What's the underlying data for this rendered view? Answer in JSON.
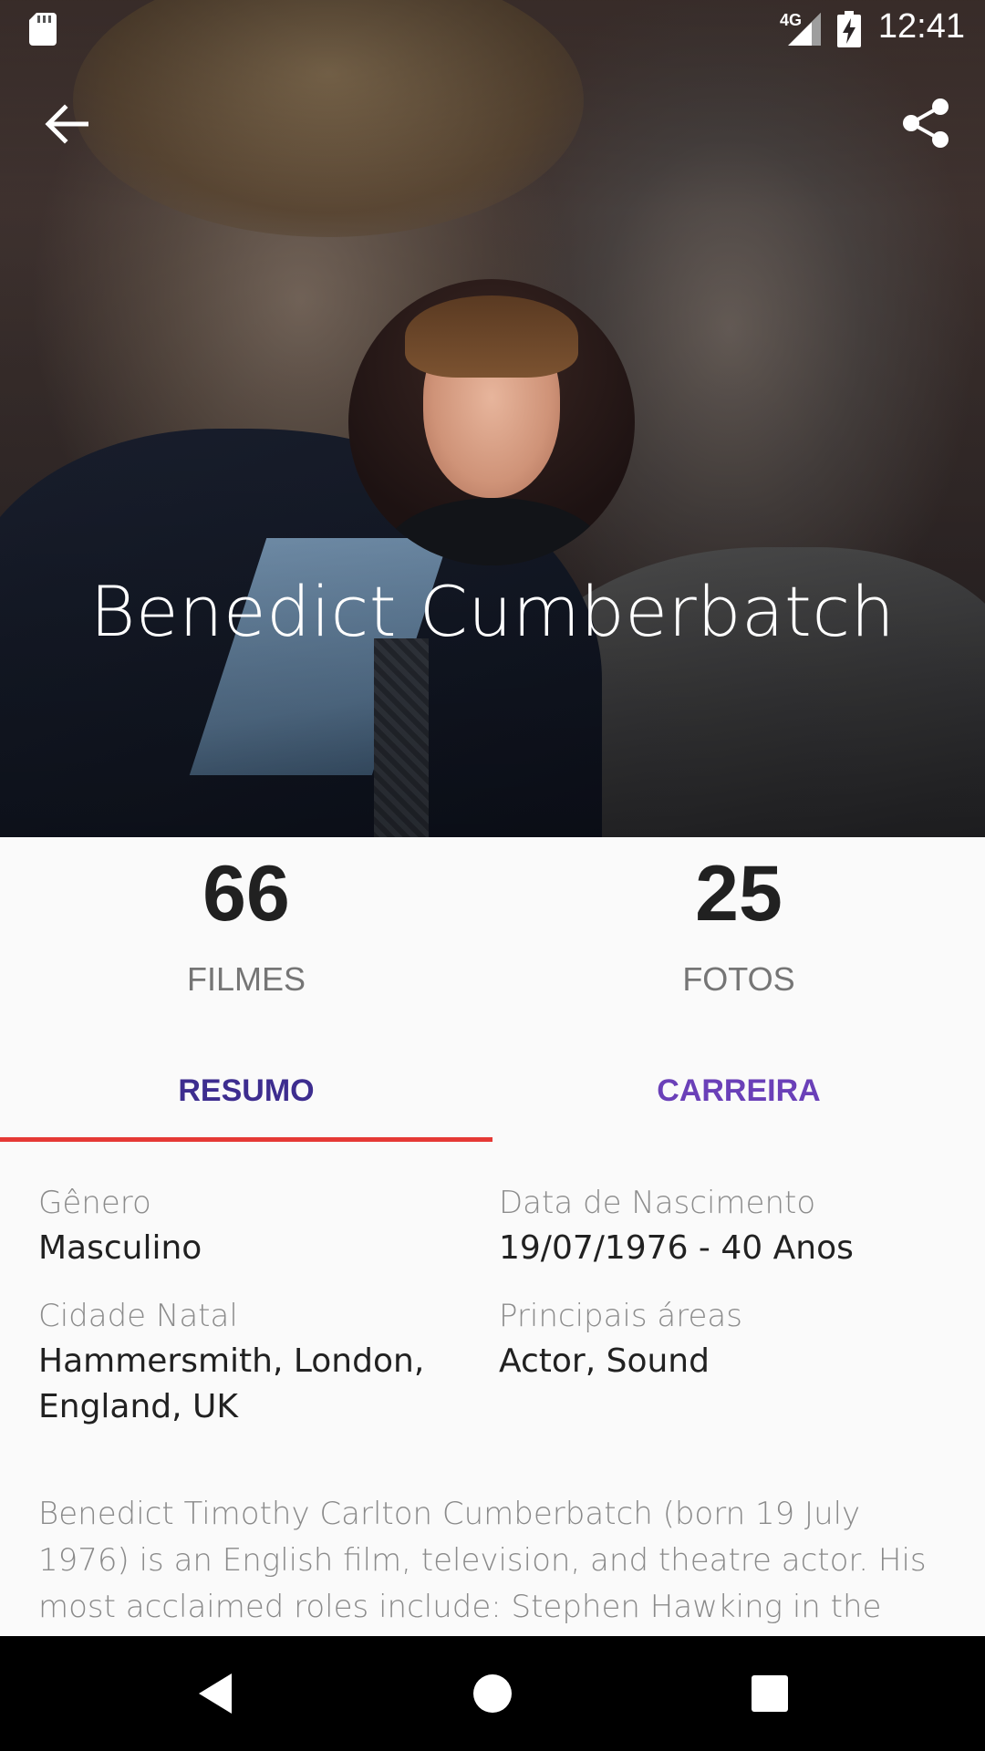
{
  "status_bar": {
    "network": "4G",
    "time": "12:41"
  },
  "toolbar": {
    "back_icon": "arrow-back-icon",
    "share_icon": "share-icon"
  },
  "profile": {
    "name": "Benedict Cumberbatch"
  },
  "stats": {
    "films": {
      "value": "66",
      "label": "FILMES"
    },
    "photos": {
      "value": "25",
      "label": "FOTOS"
    }
  },
  "tabs": [
    {
      "label": "RESUMO",
      "active": true,
      "color": "#3d2d8f"
    },
    {
      "label": "CARREIRA",
      "active": false,
      "color": "#6a40b8"
    }
  ],
  "accent_color": "#e53935",
  "details": {
    "gender": {
      "label": "Gênero",
      "value": "Masculino"
    },
    "birth": {
      "label": "Data de Nascimento",
      "value": "19/07/1976 - 40 Anos"
    },
    "city": {
      "label": "Cidade Natal",
      "value": "Hammersmith, London, England, UK"
    },
    "areas": {
      "label": "Principais áreas",
      "value": "Actor, Sound"
    }
  },
  "bio": "Benedict Timothy Carlton Cumberbatch (born 19 July 1976) is an English film, television, and theatre actor. His most acclaimed roles include: Stephen Hawking in the",
  "nav": {
    "back_icon": "nav-back-icon",
    "home_icon": "nav-home-icon",
    "recents_icon": "nav-recents-icon"
  }
}
